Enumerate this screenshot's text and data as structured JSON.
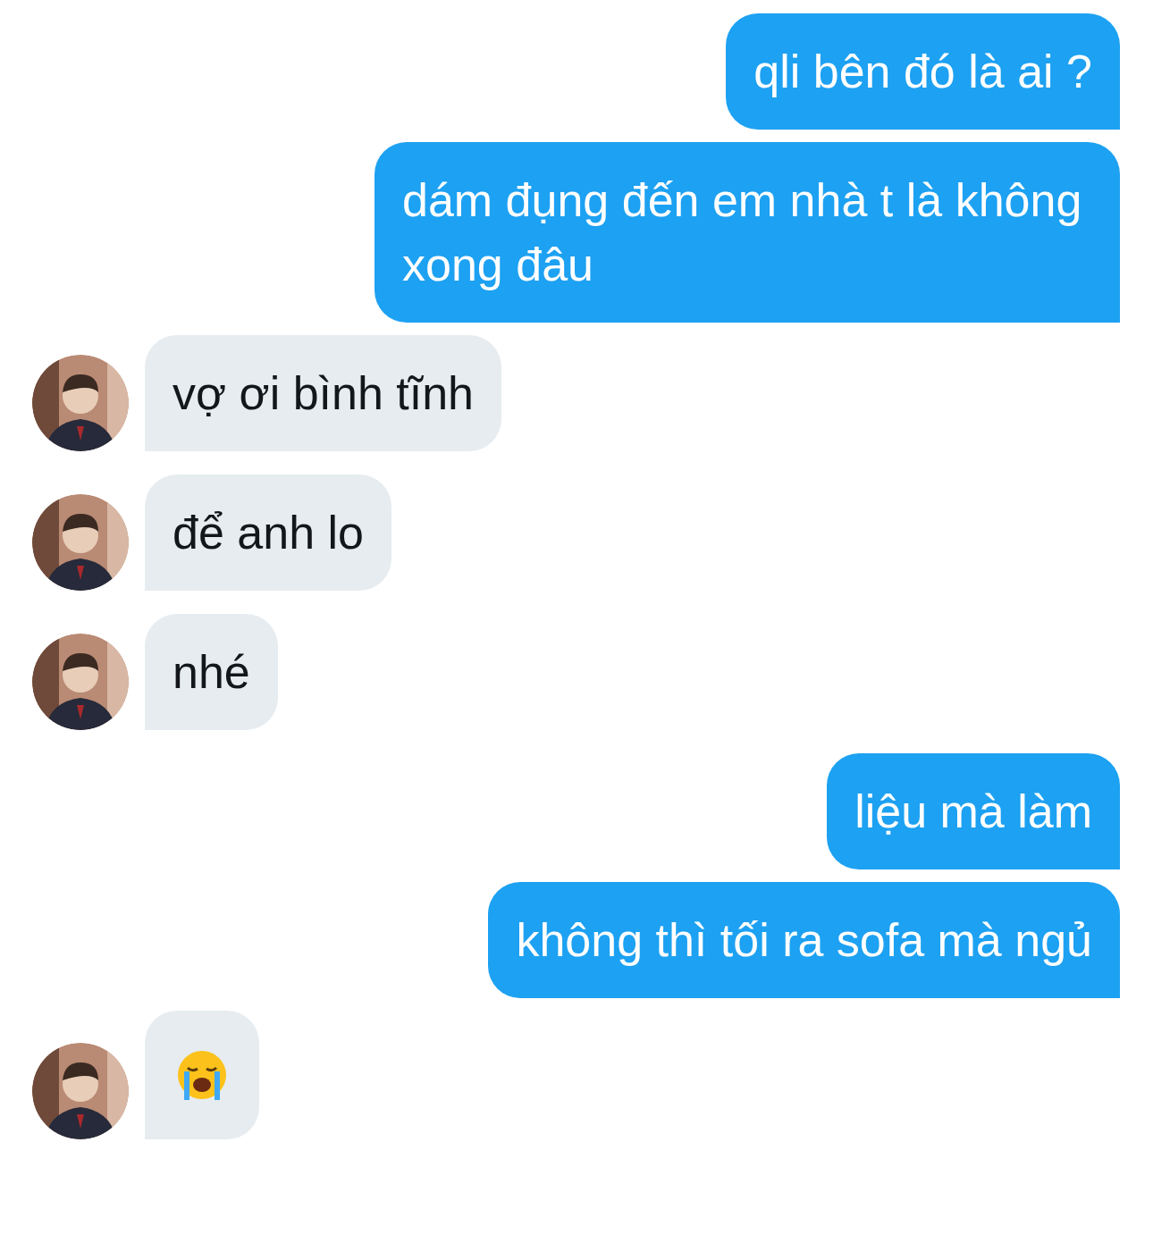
{
  "messages": [
    {
      "kind": "sent",
      "text": "qli bên đó là ai ?"
    },
    {
      "kind": "sent",
      "text": "dám đụng đến em nhà t là không xong đâu"
    },
    {
      "kind": "received",
      "text": "vợ ơi bình tĩnh"
    },
    {
      "kind": "received",
      "text": "để anh lo"
    },
    {
      "kind": "received",
      "text": "nhé"
    },
    {
      "kind": "sent",
      "text": "liệu mà làm"
    },
    {
      "kind": "sent",
      "text": "không thì tối ra sofa mà ngủ"
    },
    {
      "kind": "emoji"
    }
  ]
}
